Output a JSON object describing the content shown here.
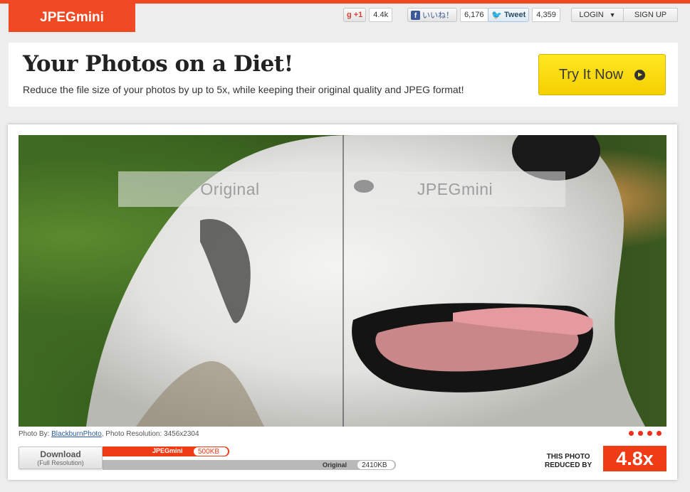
{
  "brand": {
    "logo": "JPEGmini",
    "accent": "#ef4a23"
  },
  "social": {
    "gplus_label": "+1",
    "gplus_count": "4.4k",
    "fb_icon": "f",
    "fb_label": "いいね！",
    "fb_count": "6,176",
    "tw_label": "Tweet",
    "tw_count": "4,359"
  },
  "auth": {
    "login": "LOGIN",
    "login_caret": "▼",
    "signup": "SIGN UP"
  },
  "hero": {
    "title": "Your Photos on a Diet!",
    "subtitle": "Reduce the file size of your photos by up to 5x, while keeping their original quality and JPEG format!",
    "cta": "Try It Now"
  },
  "viewer": {
    "label_left": "Original",
    "label_right": "JPEGmini",
    "credit_prefix": "Photo By:",
    "credit_author": "BlackburnPhoto",
    "credit_suffix": ", Photo Resolution: 3456x2304",
    "slide_count": 4
  },
  "download": {
    "label": "Download",
    "sublabel": "(Full Resolution)"
  },
  "sizes": {
    "jpegmini_label": "JPEGmini",
    "jpegmini_size": "500KB",
    "original_label": "Original",
    "original_size": "2410KB"
  },
  "result": {
    "line1": "THIS PHOTO",
    "line2": "REDUCED BY",
    "ratio": "4.8x"
  }
}
